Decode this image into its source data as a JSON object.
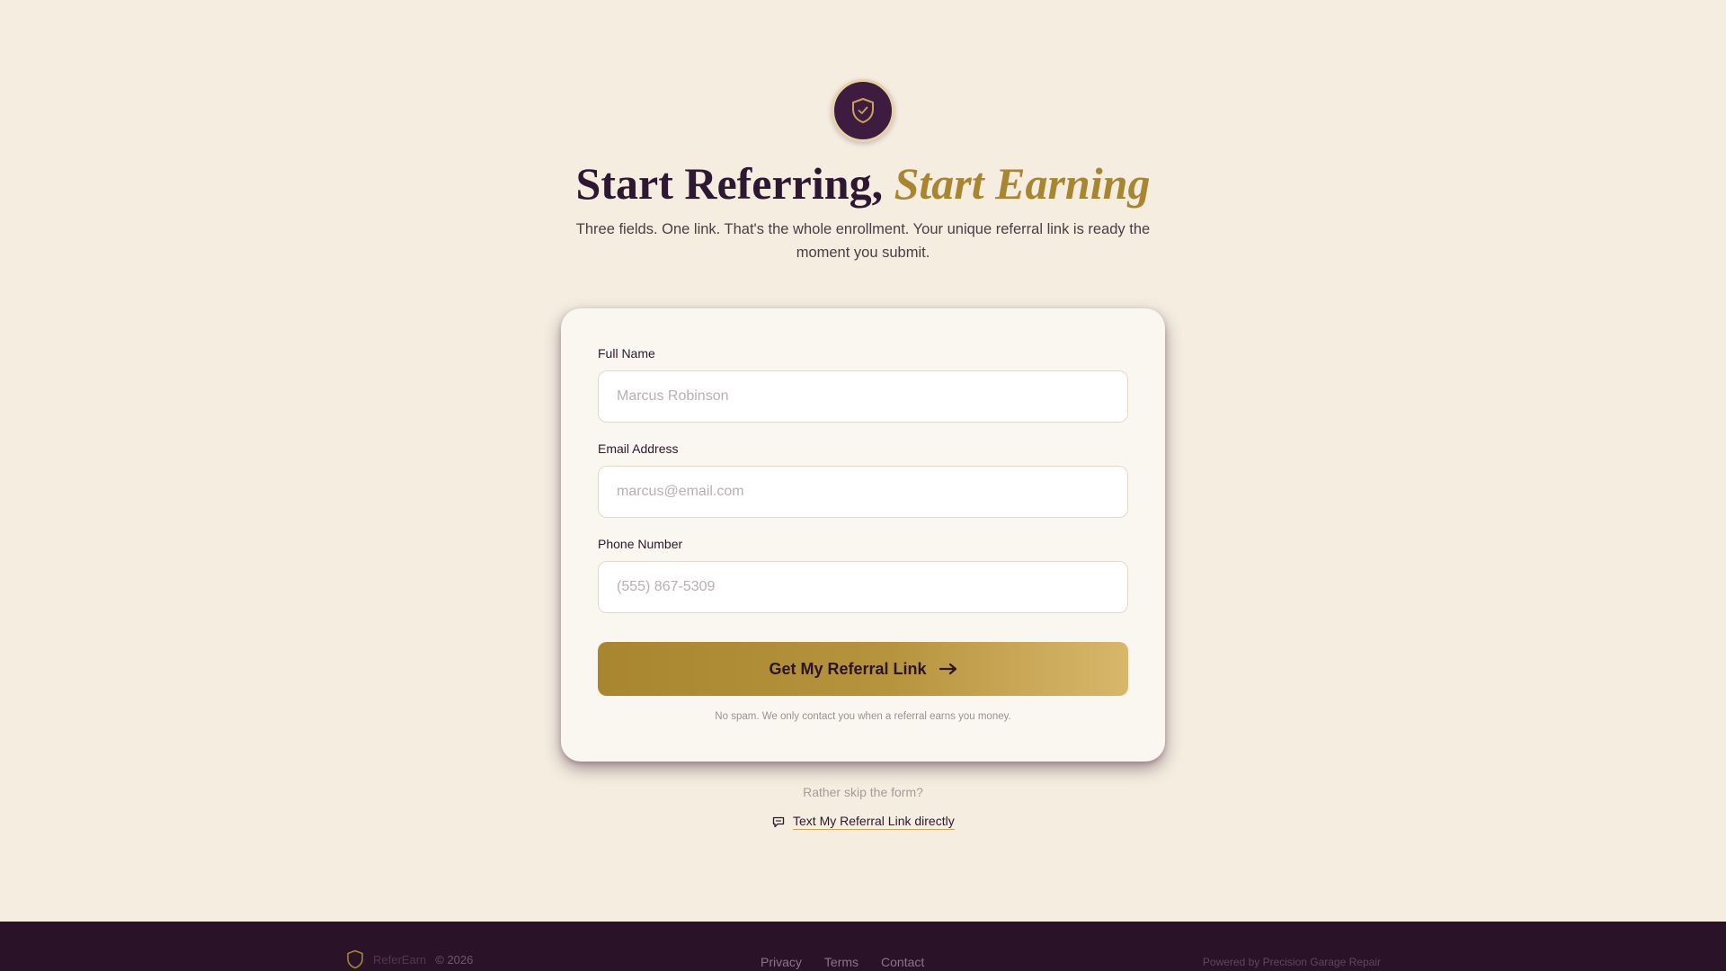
{
  "header": {
    "title_main": "Start Referring, ",
    "title_accent": "Start Earning",
    "subtitle": "Three fields. One link. That's the whole enrollment. Your unique referral link is ready the moment you submit."
  },
  "form": {
    "full_name": {
      "label": "Full Name",
      "placeholder": "Marcus Robinson",
      "value": ""
    },
    "email": {
      "label": "Email Address",
      "placeholder": "marcus@email.com",
      "value": ""
    },
    "phone": {
      "label": "Phone Number",
      "placeholder": "(555) 867-5309",
      "value": ""
    },
    "submit_label": "Get My Referral Link",
    "fine_print": "No spam. We only contact you when a referral earns you money."
  },
  "alternate": {
    "prompt": "Rather skip the form?",
    "link_label": "Text My Referral Link directly"
  },
  "footer": {
    "brand": "ReferEarn",
    "copyright": "© 2026",
    "links": [
      "Privacy",
      "Terms",
      "Contact"
    ],
    "powered_by": "Powered by Precision Garage Repair"
  },
  "icons": {
    "logo": "shield-check-icon",
    "submit": "arrow-right-icon",
    "sms": "chat-bubble-icon",
    "footer_logo": "shield-icon"
  },
  "colors": {
    "background": "#f4ede0",
    "plum": "#3d1c3f",
    "gold": "#a8852f",
    "footer": "#2a1228"
  }
}
